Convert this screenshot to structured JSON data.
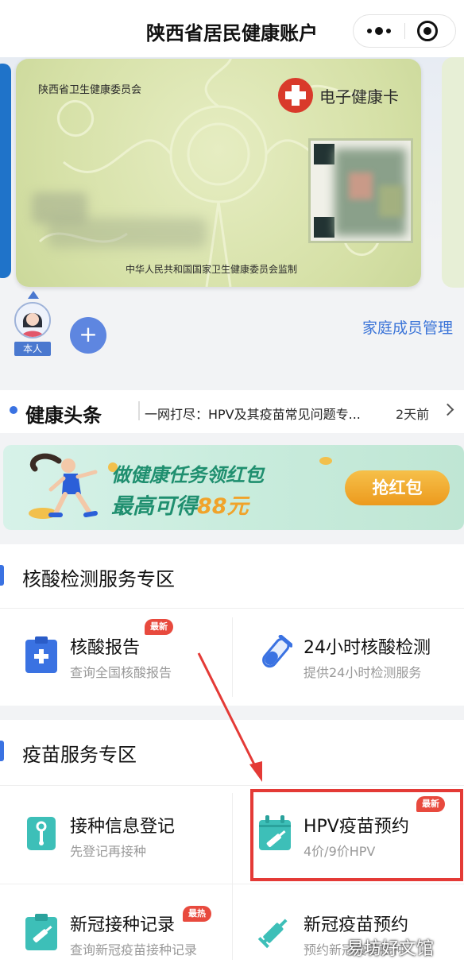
{
  "titlebar": {
    "title": "陕西省居民健康账户"
  },
  "card": {
    "issuer": "陕西省卫生健康委员会",
    "type_label": "电子健康卡",
    "supervision": "中华人民共和国国家卫生健康委员会监制",
    "card_color": "#d5e0a6"
  },
  "members": {
    "self_label": "本人",
    "add_symbol": "+",
    "manage_label": "家庭成员管理"
  },
  "headline": {
    "title": "健康头条",
    "news": "一网打尽：HPV及其疫苗常见问题专...",
    "time": "2天前"
  },
  "banner": {
    "line1": "做健康任务领红包",
    "line2_prefix": "最高可得",
    "line2_amount": "88元",
    "button": "抢红包"
  },
  "nucleic": {
    "title": "核酸检测服务专区",
    "items": [
      {
        "name": "核酸报告",
        "desc": "查询全国核酸报告",
        "badge": "最新",
        "icon": "clipboard-plus-icon"
      },
      {
        "name": "24小时核酸检测",
        "desc": "提供24小时检测服务",
        "badge": "",
        "icon": "test-tube-icon"
      }
    ]
  },
  "vaccine": {
    "title": "疫苗服务专区",
    "items": [
      {
        "name": "接种信息登记",
        "desc": "先登记再接种",
        "badge": "",
        "icon": "registration-tag-icon"
      },
      {
        "name": "HPV疫苗预约",
        "desc": "4价/9价HPV",
        "badge": "最新",
        "icon": "calendar-syringe-icon"
      },
      {
        "name": "新冠接种记录",
        "desc": "查询新冠疫苗接种记录",
        "badge": "最热",
        "icon": "clipboard-syringe-icon"
      },
      {
        "name": "新冠疫苗预约",
        "desc": "预约新冠疫苗接种",
        "badge": "",
        "icon": "syringe-icon"
      }
    ]
  },
  "watermark": "易坊好文馆",
  "colors": {
    "accent": "#3a72e2",
    "badge": "#e84a3e",
    "highlight": "#e43a36",
    "icon_blue": "#3a72e2",
    "icon_teal": "#3dbfb8"
  }
}
